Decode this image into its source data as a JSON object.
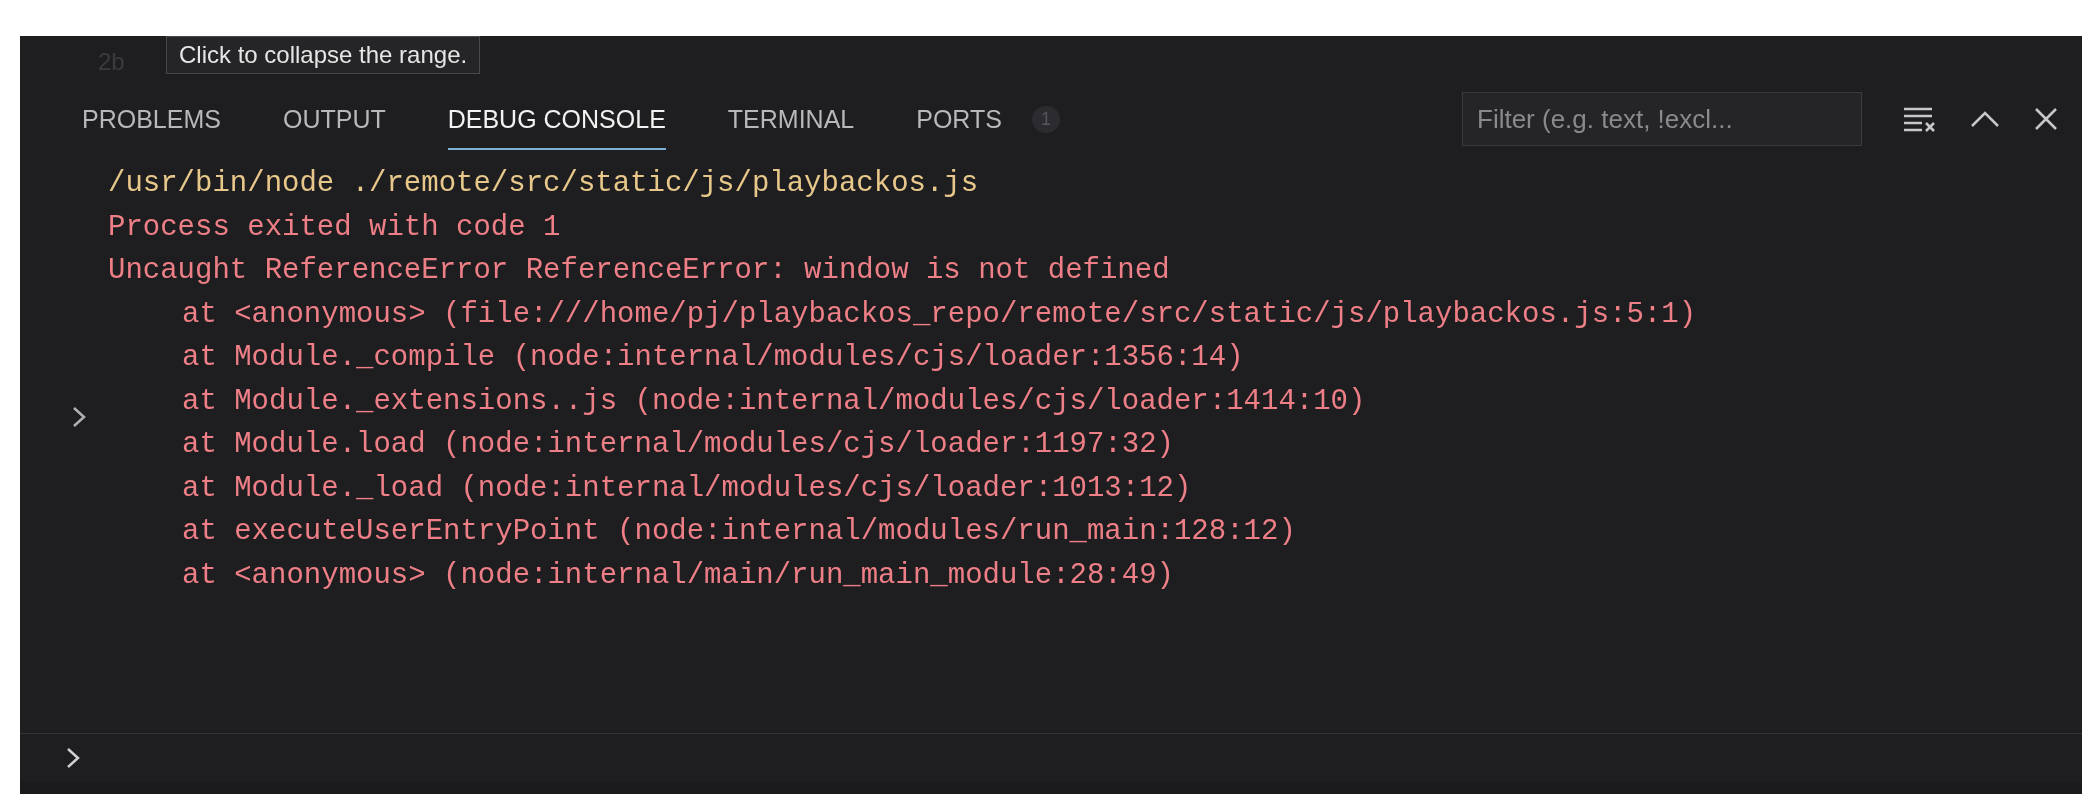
{
  "editor": {
    "line_number": "2b",
    "tooltip": "Click to collapse the range."
  },
  "tabs": [
    {
      "label": "PROBLEMS",
      "selected": false
    },
    {
      "label": "OUTPUT",
      "selected": false
    },
    {
      "label": "DEBUG CONSOLE",
      "selected": true
    },
    {
      "label": "TERMINAL",
      "selected": false
    },
    {
      "label": "PORTS",
      "selected": false,
      "badge": "1"
    }
  ],
  "filter": {
    "placeholder": "Filter (e.g. text, !excl..."
  },
  "console": {
    "lines": [
      {
        "kind": "command",
        "text": "/usr/bin/node ./remote/src/static/js/playbackos.js"
      },
      {
        "kind": "error",
        "text": "Process exited with code 1"
      },
      {
        "kind": "error",
        "text": "Uncaught ReferenceError ReferenceError: window is not defined"
      },
      {
        "kind": "stack",
        "text": "at <anonymous> (file:///home/pj/playbackos_repo/remote/src/static/js/playbackos.js:5:1)"
      },
      {
        "kind": "stack",
        "text": "at Module._compile (node:internal/modules/cjs/loader:1356:14)"
      },
      {
        "kind": "stack",
        "text": "at Module._extensions..js (node:internal/modules/cjs/loader:1414:10)"
      },
      {
        "kind": "stack",
        "text": "at Module.load (node:internal/modules/cjs/loader:1197:32)"
      },
      {
        "kind": "stack",
        "text": "at Module._load (node:internal/modules/cjs/loader:1013:12)"
      },
      {
        "kind": "stack",
        "text": "at executeUserEntryPoint (node:internal/modules/run_main:128:12)"
      },
      {
        "kind": "stack",
        "text": "at <anonymous> (node:internal/main/run_main_module:28:49)"
      }
    ]
  }
}
